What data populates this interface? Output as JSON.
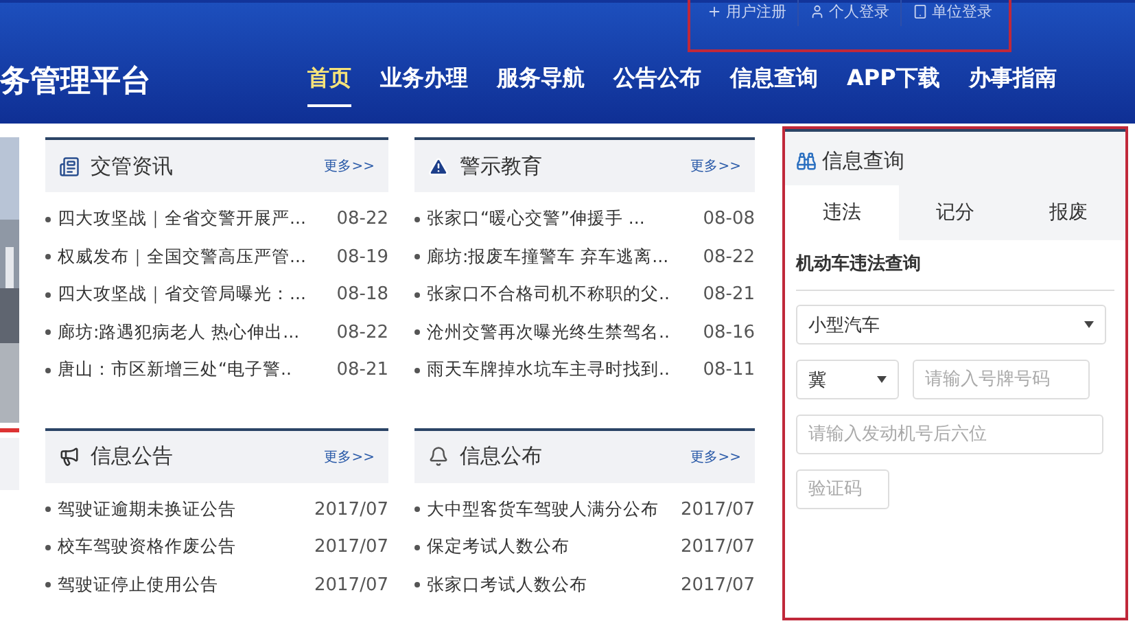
{
  "header": {
    "logo": "务管理平台",
    "top_links": [
      {
        "label": "用户注册",
        "kind": "plus"
      },
      {
        "label": "个人登录",
        "kind": "user"
      },
      {
        "label": "单位登录",
        "kind": "tablet"
      }
    ],
    "nav": [
      {
        "label": "首页",
        "selected": true
      },
      {
        "label": "业务办理",
        "selected": false
      },
      {
        "label": "服务导航",
        "selected": false
      },
      {
        "label": "公告公布",
        "selected": false
      },
      {
        "label": "信息查询",
        "selected": false
      },
      {
        "label": "APP下载",
        "selected": false
      },
      {
        "label": "办事指南",
        "selected": false
      }
    ]
  },
  "panels": [
    {
      "title": "交管资讯",
      "kind": "news",
      "more": "更多>>",
      "items": [
        {
          "title": "四大攻坚战｜全省交警开展严...",
          "date": "08-22"
        },
        {
          "title": "权威发布｜全国交警高压严管...",
          "date": "08-19"
        },
        {
          "title": "四大攻坚战｜省交管局曝光：...",
          "date": "08-18"
        },
        {
          "title": "廊坊:路遇犯病老人 热心伸出...",
          "date": "08-22"
        },
        {
          "title": "唐山：市区新增三处“电子警..",
          "date": "08-21"
        }
      ]
    },
    {
      "title": "警示教育",
      "kind": "warning",
      "more": "更多>>",
      "items": [
        {
          "title": "张家口“暖心交警”伸援手 ...",
          "date": "08-08"
        },
        {
          "title": "廊坊:报废车撞警车 弃车逃离...",
          "date": "08-22"
        },
        {
          "title": "张家口不合格司机不称职的父..",
          "date": "08-21"
        },
        {
          "title": "沧州交警再次曝光终生禁驾名..",
          "date": "08-16"
        },
        {
          "title": "雨天车牌掉水坑车主寻时找到..",
          "date": "08-11"
        }
      ]
    },
    {
      "title": "信息公告",
      "kind": "megaphone",
      "more": "更多>>",
      "items": [
        {
          "title": "驾驶证逾期未换证公告",
          "date": "2017/07"
        },
        {
          "title": "校车驾驶资格作废公告",
          "date": "2017/07"
        },
        {
          "title": "驾驶证停止使用公告",
          "date": "2017/07"
        }
      ]
    },
    {
      "title": "信息公布",
      "kind": "bell",
      "more": "更多>>",
      "items": [
        {
          "title": "大中型客货车驾驶人满分公布",
          "date": "2017/07"
        },
        {
          "title": "保定考试人数公布",
          "date": "2017/07"
        },
        {
          "title": "张家口考试人数公布",
          "date": "2017/07"
        }
      ]
    }
  ],
  "query": {
    "title": "信息查询",
    "tabs": [
      {
        "label": "违法",
        "selected": true
      },
      {
        "label": "记分",
        "selected": false
      },
      {
        "label": "报废",
        "selected": false
      }
    ],
    "subtitle": "机动车违法查询",
    "vehicle_type": "小型汽车",
    "province": "冀",
    "plate_placeholder": "请输入号牌号码",
    "engine_placeholder": "请输入发动机号后六位",
    "captcha_placeholder": "验证码"
  }
}
